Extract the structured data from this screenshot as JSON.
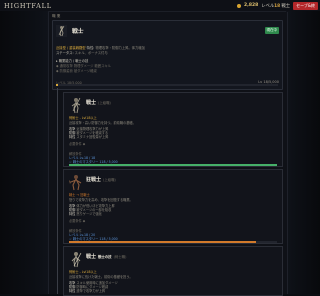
{
  "topbar": {
    "title": "HIGHTFALL",
    "gold": "2,828",
    "level_label": "レベル",
    "level_value": "18",
    "level_class": "戦士",
    "save_button": "セーブ&終"
  },
  "panel": {
    "header": "職 業",
    "current": {
      "icon": "warrior-sword-icon",
      "title": "戦士",
      "equipped_badge": "現在中",
      "line1_tag": "近接型 / 重装戦闘型",
      "line1_label": "特性:",
      "line1_text": "物理攻撃・防御力上昇。体力増加",
      "line2_label": "ステータス:",
      "line2_text": "スキル、ボーナス付与",
      "section_label": "▸ 職業能力 / 戦士の技",
      "skill1": "◆ 通常攻撃 物理ダメージ 範囲スキル",
      "skill2": "◆ 防御姿勢 被ダメージ軽減",
      "xp_label": "レベル 18/5,000",
      "xp_fraction": 0.0036,
      "xp_right": "Lv 18/5,000"
    },
    "cards": [
      {
        "name": "戦士",
        "subtitle": "(上級職)",
        "tag": "剣術士 - Lvl18以上",
        "desc": "近接攻撃・高い防御力を持つ。前衛職の基礎。",
        "traits": [
          {
            "label": "攻撃",
            "text": "近接物理攻撃力が上昇"
          },
          {
            "label": "防御",
            "text": "被ダメージを軽減する"
          },
          {
            "label": "特性",
            "text": "スタミナ回復量が上昇"
          }
        ],
        "note": "必要条件 ◆",
        "unlock_title": "解放条件",
        "level_req": "レベル Lv.18 / 18",
        "mastery": "☆ 戦士のマスタリー 118 / 5,000",
        "progress": 1.0,
        "icon": "warrior-icon",
        "accent": "#46b069"
      },
      {
        "name": "狂戦士",
        "subtitle": "(上級職)",
        "tag": "戦士 → 狂戦士",
        "desc": "怒りで攻撃力を高め、攻撃を回復する職業。",
        "traits": [
          {
            "label": "攻撃",
            "text": "体力が低いほど攻撃力上昇"
          },
          {
            "label": "防御",
            "text": "被ダメージの一部を吸収"
          },
          {
            "label": "特性",
            "text": "怒りゲージで強化"
          }
        ],
        "note": "必要条件 ◆",
        "unlock_title": "解放条件",
        "level_req": "レベル Lv.18 / 20",
        "mastery": "☆ 戦士のマスタリー 118 / 5,000",
        "progress": 0.9,
        "icon": "berserker-icon",
        "accent": "#d27a2b"
      },
      {
        "name": "戦士",
        "subtitle_badge": "戦士の技",
        "subtitle": "(剣士職)",
        "tag": "剣術士 - Lvl18以上",
        "desc": "近接攻撃に長けた戦士。前衛の基礎を担う。",
        "traits": [
          {
            "label": "攻撃",
            "text": "スキル使用時に追加ダメージ"
          },
          {
            "label": "防御",
            "text": "防御時にダメージ軽減"
          },
          {
            "label": "特性",
            "text": "連撃で攻撃力が上昇"
          }
        ],
        "icon": "swordsman-icon",
        "accent": "#46b069"
      }
    ]
  }
}
